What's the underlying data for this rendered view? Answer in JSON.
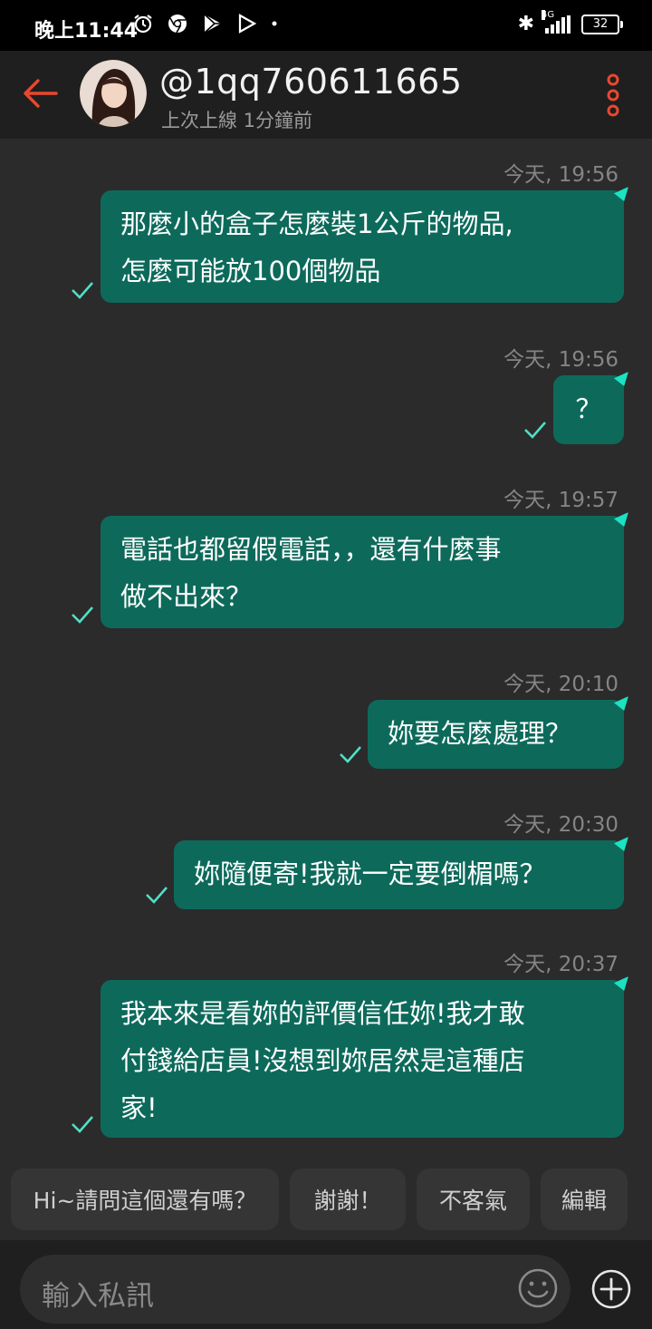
{
  "status_bar": {
    "time": "晚上11:44",
    "icons_left": [
      "alarm-icon",
      "chrome-icon",
      "play-store-icon",
      "play-icon",
      "dot-icon"
    ],
    "network": "4G",
    "battery": "32"
  },
  "header": {
    "username": "@1qq760611665",
    "last_seen": "上次上線 1分鐘前",
    "accent_color": "#e8482f"
  },
  "messages": [
    {
      "time": "今天, 19:56",
      "lines": [
        "那麼小的盒子怎麼裝1公斤的物品,",
        "怎麼可能放100個物品"
      ]
    },
    {
      "time": "今天, 19:56",
      "lines": [
        "？"
      ]
    },
    {
      "time": "今天, 19:57",
      "lines": [
        "電話也都留假電話，，還有什麼事",
        "做不出來？"
      ]
    },
    {
      "time": "今天, 20:10",
      "lines": [
        "妳要怎麼處理？"
      ]
    },
    {
      "time": "今天, 20:30",
      "lines": [
        "妳隨便寄!我就一定要倒楣嗎？"
      ]
    },
    {
      "time": "今天, 20:37",
      "lines": [
        "我本來是看妳的評價信任妳!我才敢",
        "付錢給店員!沒想到妳居然是這種店",
        "家!"
      ]
    }
  ],
  "quick_replies": [
    "Hi~請問這個還有嗎？",
    "謝謝！",
    "不客氣",
    "編輯"
  ],
  "input": {
    "placeholder": "輸入私訊"
  },
  "colors": {
    "bubble": "#0d6a5b",
    "check": "#4fe0c8",
    "background": "#2b2b2b"
  }
}
